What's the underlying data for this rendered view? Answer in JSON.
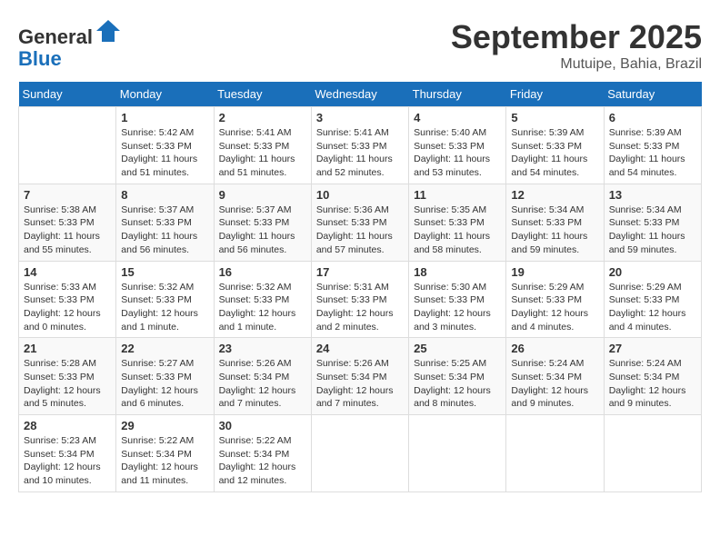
{
  "header": {
    "logo_line1": "General",
    "logo_line2": "Blue",
    "month": "September 2025",
    "location": "Mutuipe, Bahia, Brazil"
  },
  "days_of_week": [
    "Sunday",
    "Monday",
    "Tuesday",
    "Wednesday",
    "Thursday",
    "Friday",
    "Saturday"
  ],
  "weeks": [
    [
      {
        "day": "",
        "info": ""
      },
      {
        "day": "1",
        "info": "Sunrise: 5:42 AM\nSunset: 5:33 PM\nDaylight: 11 hours\nand 51 minutes."
      },
      {
        "day": "2",
        "info": "Sunrise: 5:41 AM\nSunset: 5:33 PM\nDaylight: 11 hours\nand 51 minutes."
      },
      {
        "day": "3",
        "info": "Sunrise: 5:41 AM\nSunset: 5:33 PM\nDaylight: 11 hours\nand 52 minutes."
      },
      {
        "day": "4",
        "info": "Sunrise: 5:40 AM\nSunset: 5:33 PM\nDaylight: 11 hours\nand 53 minutes."
      },
      {
        "day": "5",
        "info": "Sunrise: 5:39 AM\nSunset: 5:33 PM\nDaylight: 11 hours\nand 54 minutes."
      },
      {
        "day": "6",
        "info": "Sunrise: 5:39 AM\nSunset: 5:33 PM\nDaylight: 11 hours\nand 54 minutes."
      }
    ],
    [
      {
        "day": "7",
        "info": "Sunrise: 5:38 AM\nSunset: 5:33 PM\nDaylight: 11 hours\nand 55 minutes."
      },
      {
        "day": "8",
        "info": "Sunrise: 5:37 AM\nSunset: 5:33 PM\nDaylight: 11 hours\nand 56 minutes."
      },
      {
        "day": "9",
        "info": "Sunrise: 5:37 AM\nSunset: 5:33 PM\nDaylight: 11 hours\nand 56 minutes."
      },
      {
        "day": "10",
        "info": "Sunrise: 5:36 AM\nSunset: 5:33 PM\nDaylight: 11 hours\nand 57 minutes."
      },
      {
        "day": "11",
        "info": "Sunrise: 5:35 AM\nSunset: 5:33 PM\nDaylight: 11 hours\nand 58 minutes."
      },
      {
        "day": "12",
        "info": "Sunrise: 5:34 AM\nSunset: 5:33 PM\nDaylight: 11 hours\nand 59 minutes."
      },
      {
        "day": "13",
        "info": "Sunrise: 5:34 AM\nSunset: 5:33 PM\nDaylight: 11 hours\nand 59 minutes."
      }
    ],
    [
      {
        "day": "14",
        "info": "Sunrise: 5:33 AM\nSunset: 5:33 PM\nDaylight: 12 hours\nand 0 minutes."
      },
      {
        "day": "15",
        "info": "Sunrise: 5:32 AM\nSunset: 5:33 PM\nDaylight: 12 hours\nand 1 minute."
      },
      {
        "day": "16",
        "info": "Sunrise: 5:32 AM\nSunset: 5:33 PM\nDaylight: 12 hours\nand 1 minute."
      },
      {
        "day": "17",
        "info": "Sunrise: 5:31 AM\nSunset: 5:33 PM\nDaylight: 12 hours\nand 2 minutes."
      },
      {
        "day": "18",
        "info": "Sunrise: 5:30 AM\nSunset: 5:33 PM\nDaylight: 12 hours\nand 3 minutes."
      },
      {
        "day": "19",
        "info": "Sunrise: 5:29 AM\nSunset: 5:33 PM\nDaylight: 12 hours\nand 4 minutes."
      },
      {
        "day": "20",
        "info": "Sunrise: 5:29 AM\nSunset: 5:33 PM\nDaylight: 12 hours\nand 4 minutes."
      }
    ],
    [
      {
        "day": "21",
        "info": "Sunrise: 5:28 AM\nSunset: 5:33 PM\nDaylight: 12 hours\nand 5 minutes."
      },
      {
        "day": "22",
        "info": "Sunrise: 5:27 AM\nSunset: 5:33 PM\nDaylight: 12 hours\nand 6 minutes."
      },
      {
        "day": "23",
        "info": "Sunrise: 5:26 AM\nSunset: 5:34 PM\nDaylight: 12 hours\nand 7 minutes."
      },
      {
        "day": "24",
        "info": "Sunrise: 5:26 AM\nSunset: 5:34 PM\nDaylight: 12 hours\nand 7 minutes."
      },
      {
        "day": "25",
        "info": "Sunrise: 5:25 AM\nSunset: 5:34 PM\nDaylight: 12 hours\nand 8 minutes."
      },
      {
        "day": "26",
        "info": "Sunrise: 5:24 AM\nSunset: 5:34 PM\nDaylight: 12 hours\nand 9 minutes."
      },
      {
        "day": "27",
        "info": "Sunrise: 5:24 AM\nSunset: 5:34 PM\nDaylight: 12 hours\nand 9 minutes."
      }
    ],
    [
      {
        "day": "28",
        "info": "Sunrise: 5:23 AM\nSunset: 5:34 PM\nDaylight: 12 hours\nand 10 minutes."
      },
      {
        "day": "29",
        "info": "Sunrise: 5:22 AM\nSunset: 5:34 PM\nDaylight: 12 hours\nand 11 minutes."
      },
      {
        "day": "30",
        "info": "Sunrise: 5:22 AM\nSunset: 5:34 PM\nDaylight: 12 hours\nand 12 minutes."
      },
      {
        "day": "",
        "info": ""
      },
      {
        "day": "",
        "info": ""
      },
      {
        "day": "",
        "info": ""
      },
      {
        "day": "",
        "info": ""
      }
    ]
  ]
}
